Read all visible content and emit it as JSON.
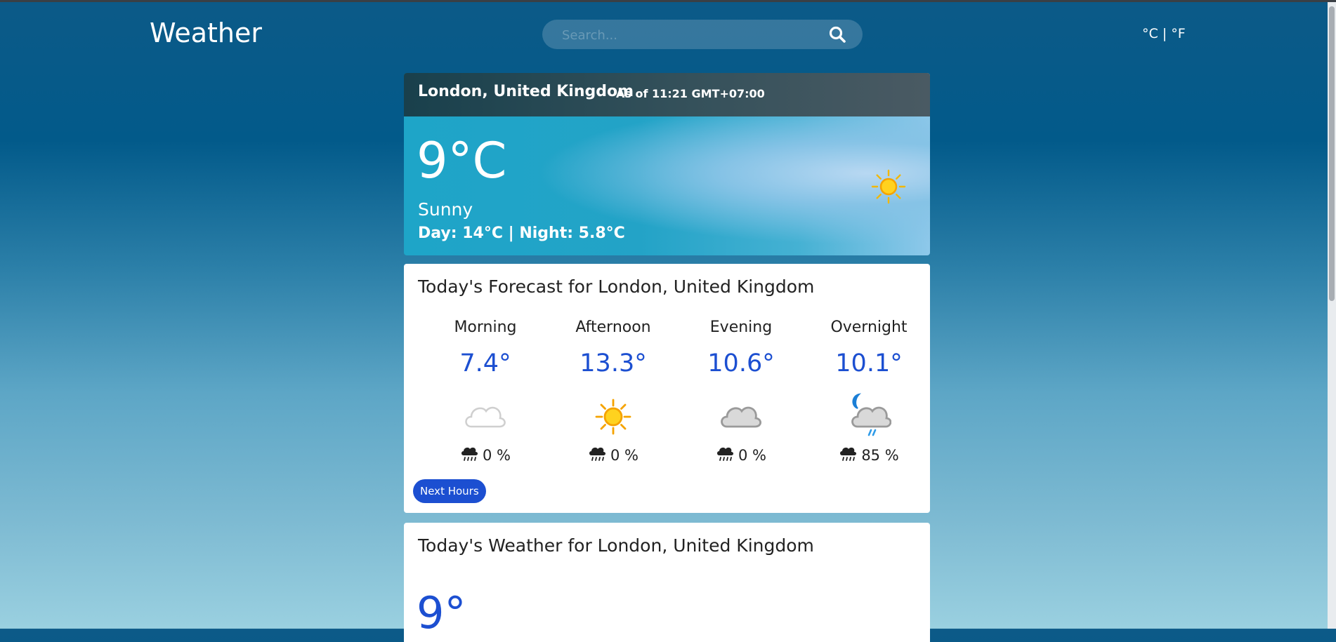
{
  "header": {
    "brand": "Weather",
    "search_placeholder": "Search...",
    "units_toggle": "°C | °F"
  },
  "current": {
    "location": "London, United Kingdom",
    "as_of": "As of 11:21 GMT+07:00",
    "temperature": "9°C",
    "condition": "Sunny",
    "day_night": "Day: 14°C | Night: 5.8°C",
    "icon": "sun-icon"
  },
  "forecast": {
    "title": "Today's Forecast for London, United Kingdom",
    "periods": [
      {
        "label": "Morning",
        "temp": "7.4°",
        "icon": "cloud-icon",
        "precip": "0 %"
      },
      {
        "label": "Afternoon",
        "temp": "13.3°",
        "icon": "sun-icon",
        "precip": "0 %"
      },
      {
        "label": "Evening",
        "temp": "10.6°",
        "icon": "cloud-icon",
        "precip": "0 %"
      },
      {
        "label": "Overnight",
        "temp": "10.1°",
        "icon": "moon-rain-cloud-icon",
        "precip": "85 %"
      }
    ],
    "precip_icon": "rain-cloud-icon",
    "next_hours_button": "Next Hours"
  },
  "today": {
    "title": "Today's Weather for London, United Kingdom",
    "temp": "9°"
  },
  "colors": {
    "accent_blue": "#1c4fd1",
    "header_bg": "#025a8a",
    "sun_yellow": "#ffc107"
  }
}
